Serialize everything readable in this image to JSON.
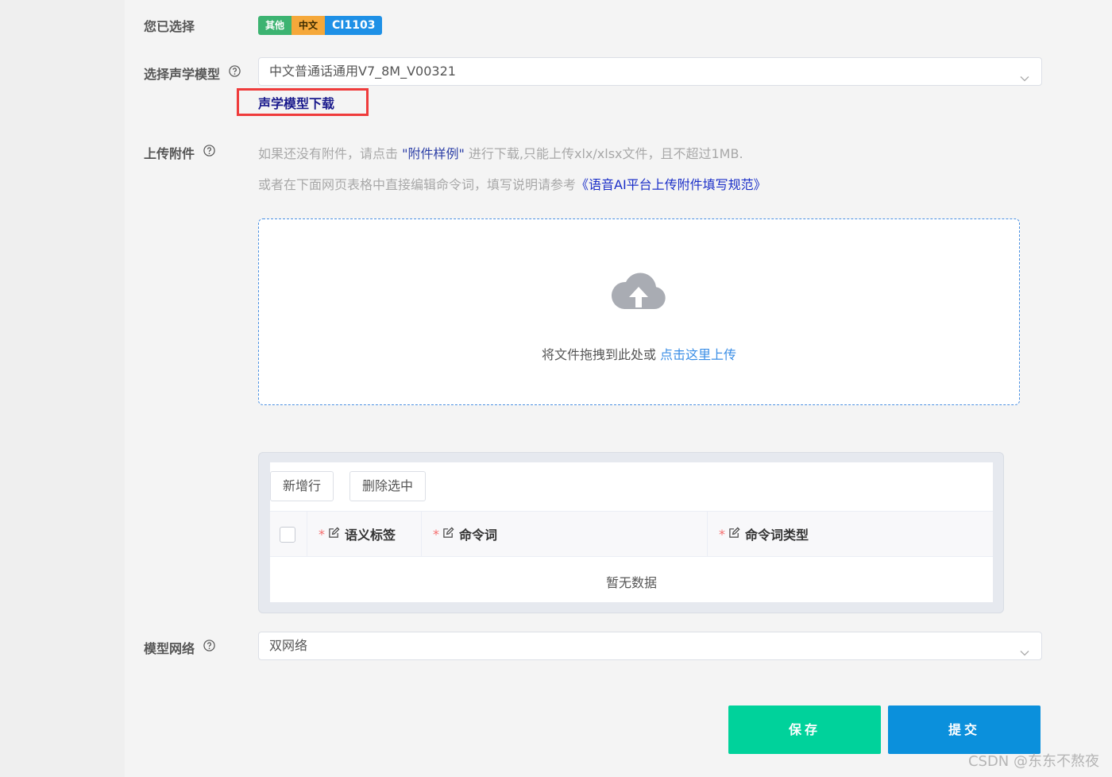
{
  "selected": {
    "label": "您已选择",
    "tags": [
      "其他",
      "中文",
      "CI1103"
    ]
  },
  "acoustic_model": {
    "label": "选择声学模型",
    "value": "中文普通话通用V7_8M_V00321",
    "download_link": "声学模型下载"
  },
  "attachment": {
    "label": "上传附件",
    "hint1_prefix": "如果还没有附件，请点击 ",
    "hint1_link": "\"附件样例\"",
    "hint1_suffix": " 进行下载,只能上传xlx/xlsx文件，且不超过1MB.",
    "hint2_prefix": "或者在下面网页表格中直接编辑命令词，填写说明请参考",
    "hint2_link": "《语音AI平台上传附件填写规范》",
    "drop_text": "将文件拖拽到此处或 ",
    "drop_link": "点击这里上传"
  },
  "table": {
    "add_row": "新增行",
    "delete_selected": "删除选中",
    "columns": [
      "语义标签",
      "命令词",
      "命令词类型"
    ],
    "required_mark": "*",
    "empty_text": "暂无数据"
  },
  "network": {
    "label": "模型网络",
    "value": "双网络"
  },
  "actions": {
    "save": "保存",
    "submit": "提交"
  },
  "watermark": "CSDN @东东不熬夜",
  "colors": {
    "save": "#00d29b",
    "submit": "#0b90dc",
    "highlight_border": "#ef3b3b",
    "link": "#3a8ee6"
  },
  "icons": [
    "help-circle-icon",
    "chevron-down-icon",
    "cloud-upload-icon",
    "edit-icon"
  ]
}
